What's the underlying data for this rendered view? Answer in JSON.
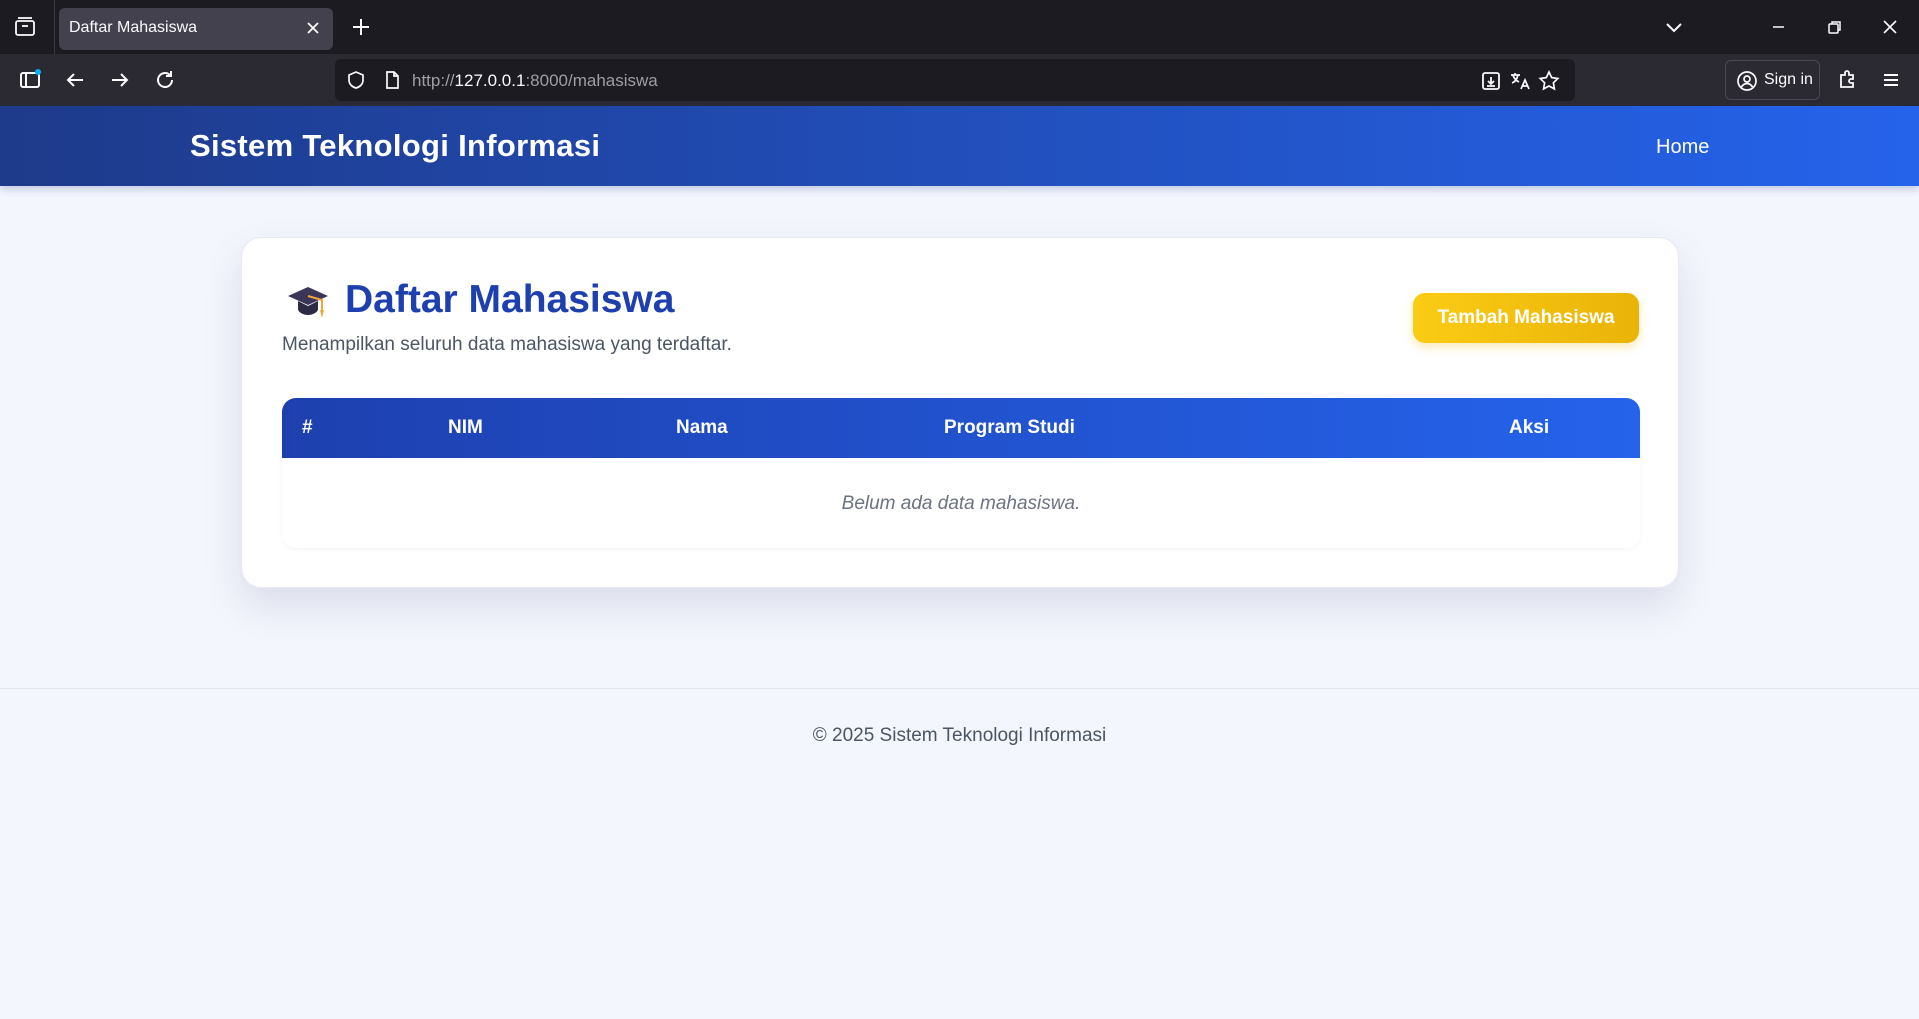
{
  "browser": {
    "tab_title": "Daftar Mahasiswa",
    "url_prefix": "http://",
    "url_host": "127.0.0.1",
    "url_rest": ":8000/mahasiswa",
    "sign_in_label": "Sign in"
  },
  "header": {
    "brand": "Sistem Teknologi Informasi",
    "nav_home": "Home",
    "gradient_start": "#1e3a8a",
    "gradient_end": "#2563eb"
  },
  "main": {
    "title_icon": "graduation-cap-icon",
    "title": "Daftar Mahasiswa",
    "subtitle": "Menampilkan seluruh data mahasiswa yang terdaftar.",
    "add_button_label": "Tambah Mahasiswa",
    "add_button_color": "#eab308",
    "table": {
      "columns": [
        "#",
        "NIM",
        "Nama",
        "Program Studi",
        "Aksi"
      ],
      "rows": [],
      "empty_message": "Belum ada data mahasiswa."
    }
  },
  "footer": {
    "text": "© 2025 Sistem Teknologi Informasi"
  }
}
